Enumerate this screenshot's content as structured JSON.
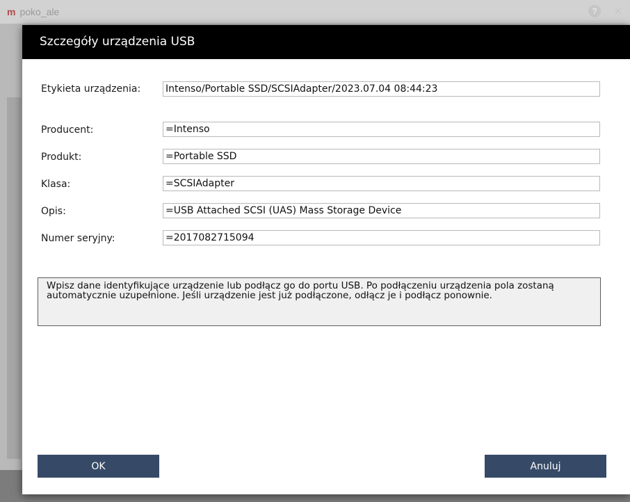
{
  "background": {
    "app_title": "poko_ale",
    "help_symbol": "?",
    "close_symbol": "×"
  },
  "dialog": {
    "title": "Szczegóły urządzenia USB",
    "fields": [
      {
        "label": "Etykieta urządzenia:",
        "value": "Intenso/Portable SSD/SCSIAdapter/2023.07.04 08:44:23"
      },
      {
        "label": "Producent:",
        "value": "=Intenso"
      },
      {
        "label": "Produkt:",
        "value": "=Portable SSD"
      },
      {
        "label": "Klasa:",
        "value": "=SCSIAdapter"
      },
      {
        "label": "Opis:",
        "value": "=USB Attached SCSI (UAS) Mass Storage Device"
      },
      {
        "label": "Numer seryjny:",
        "value": "=2017082715094"
      }
    ],
    "info_text": "Wpisz dane identyfikujące urządzenie lub podłącz go do portu USB. Po podłączeniu urządzenia pola zostaną automatycznie uzupełnione. Jeśli urządzenie jest już podłączone, odłącz je i podłącz ponownie.",
    "ok_label": "OK",
    "cancel_label": "Anuluj"
  },
  "colors": {
    "header": "#000000",
    "button": "#364a67",
    "info_box_bg": "#f0f0f0"
  }
}
